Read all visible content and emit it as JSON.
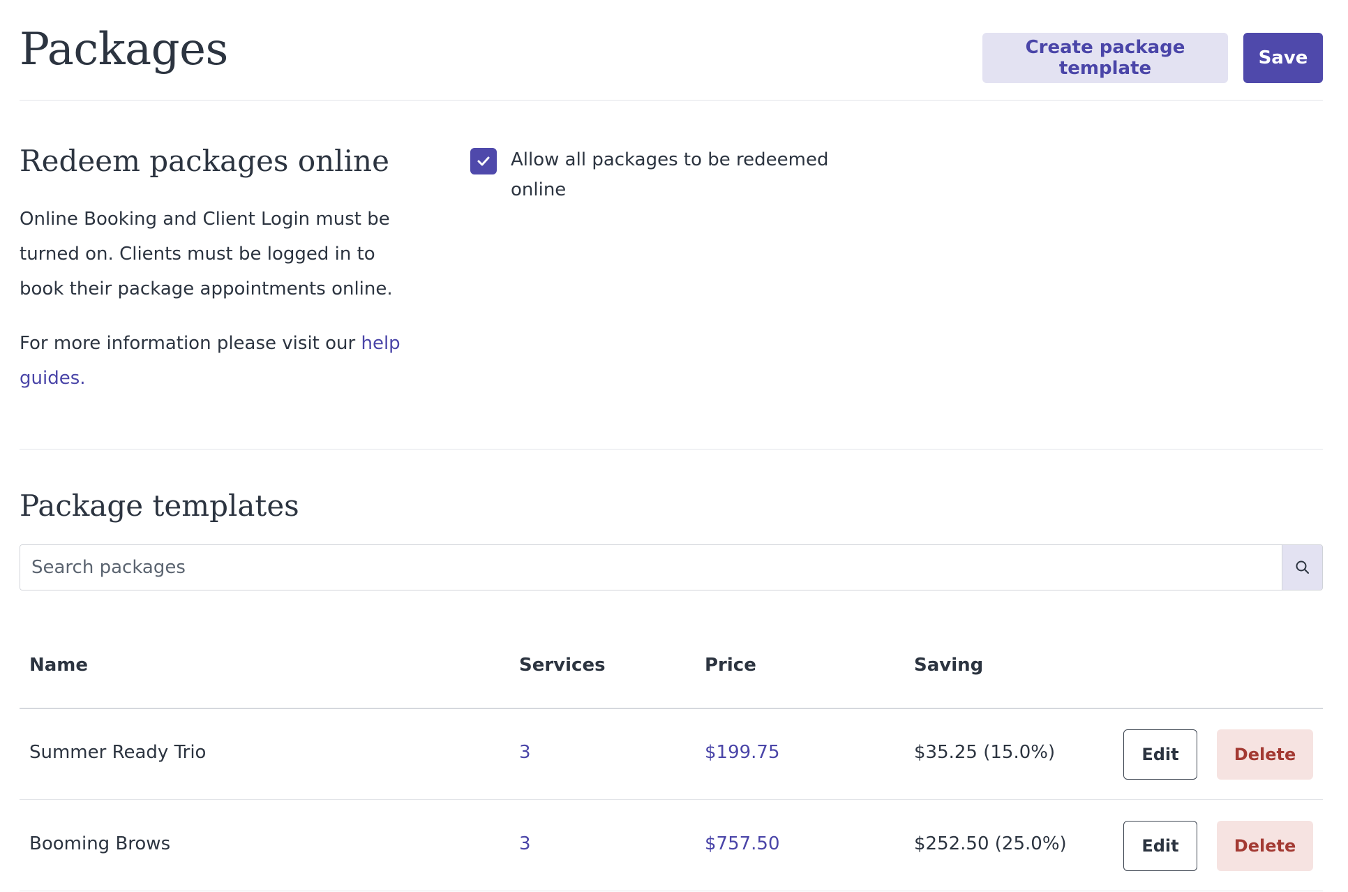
{
  "header": {
    "title": "Packages",
    "create_template_label": "Create package template",
    "save_label": "Save"
  },
  "redeem": {
    "heading": "Redeem packages online",
    "description": "Online Booking and Client Login must be turned on. Clients must be logged in to book their package appointments online.",
    "info_prefix": "For more information please visit our ",
    "info_link": "help guides.",
    "checkbox_label": "Allow all packages to be redeemed online",
    "checkbox_checked": true
  },
  "templates": {
    "heading": "Package templates",
    "search_placeholder": "Search packages",
    "search_value": "",
    "columns": {
      "name": "Name",
      "services": "Services",
      "price": "Price",
      "saving": "Saving"
    },
    "rows": [
      {
        "name": "Summer Ready Trio",
        "services": "3",
        "price": "$199.75",
        "saving": "$35.25 (15.0%)",
        "edit_label": "Edit",
        "delete_label": "Delete"
      },
      {
        "name": "Booming Brows",
        "services": "3",
        "price": "$757.50",
        "saving": "$252.50 (25.0%)",
        "edit_label": "Edit",
        "delete_label": "Delete"
      }
    ]
  },
  "colors": {
    "accent": "#4f49ab",
    "accent_light": "#e3e2f2",
    "link": "#4a45a8",
    "danger_text": "#a33a33",
    "danger_bg": "#f6e3e1"
  }
}
